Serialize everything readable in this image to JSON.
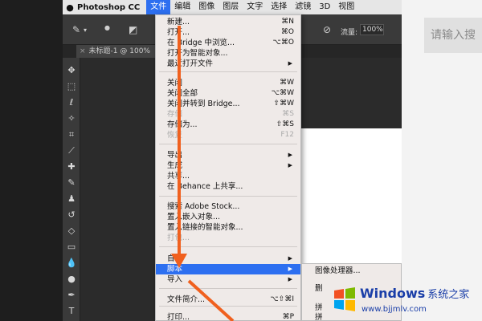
{
  "menubar": {
    "apple_icon": "apple-icon",
    "app_name": "Photoshop CC",
    "items": [
      "文件",
      "编辑",
      "图像",
      "图层",
      "文字",
      "选择",
      "滤镜",
      "3D",
      "视图"
    ],
    "active_index": 0
  },
  "options_bar": {
    "flow_label": "流量:",
    "flow_value": "100%"
  },
  "document_tab": {
    "title": "未标题-1 @ 100%"
  },
  "search": {
    "placeholder": "请输入搜"
  },
  "file_menu": {
    "items": [
      {
        "label": "新建...",
        "shortcut": "⌘N"
      },
      {
        "label": "打开...",
        "shortcut": "⌘O"
      },
      {
        "label": "在 Bridge 中浏览...",
        "shortcut": "⌥⌘O"
      },
      {
        "label": "打开为智能对象..."
      },
      {
        "label": "最近打开文件",
        "submenu": true
      },
      {
        "label": "关闭",
        "shortcut": "⌘W"
      },
      {
        "label": "关闭全部",
        "shortcut": "⌥⌘W"
      },
      {
        "label": "关闭并转到 Bridge...",
        "shortcut": "⇧⌘W"
      },
      {
        "label": "存储",
        "shortcut": "⌘S",
        "disabled": true
      },
      {
        "label": "存储为...",
        "shortcut": "⇧⌘S"
      },
      {
        "label": "恢复",
        "shortcut": "F12",
        "disabled": true
      },
      {
        "label": "导出",
        "submenu": true
      },
      {
        "label": "生成",
        "submenu": true
      },
      {
        "label": "共享..."
      },
      {
        "label": "在 Behance 上共享..."
      },
      {
        "label": "搜索 Adobe Stock..."
      },
      {
        "label": "置入嵌入对象..."
      },
      {
        "label": "置入链接的智能对象..."
      },
      {
        "label": "打包...",
        "disabled": true
      },
      {
        "label": "自动",
        "submenu": true
      },
      {
        "label": "脚本",
        "submenu": true,
        "highlight": true
      },
      {
        "label": "导入",
        "submenu": true
      },
      {
        "label": "文件简介...",
        "shortcut": "⌥⇧⌘I"
      },
      {
        "label": "打印...",
        "shortcut": "⌘P"
      }
    ]
  },
  "submenu": {
    "items": [
      "图像处理器...",
      "删",
      "拼",
      "拼"
    ]
  },
  "watermark": {
    "title": "Windows",
    "subtitle": "系统之家",
    "url": "www.bjjmlv.com"
  },
  "colors": {
    "highlight": "#2d6ff0",
    "arrow": "#f0601e",
    "menu_bg": "#efeae8"
  }
}
